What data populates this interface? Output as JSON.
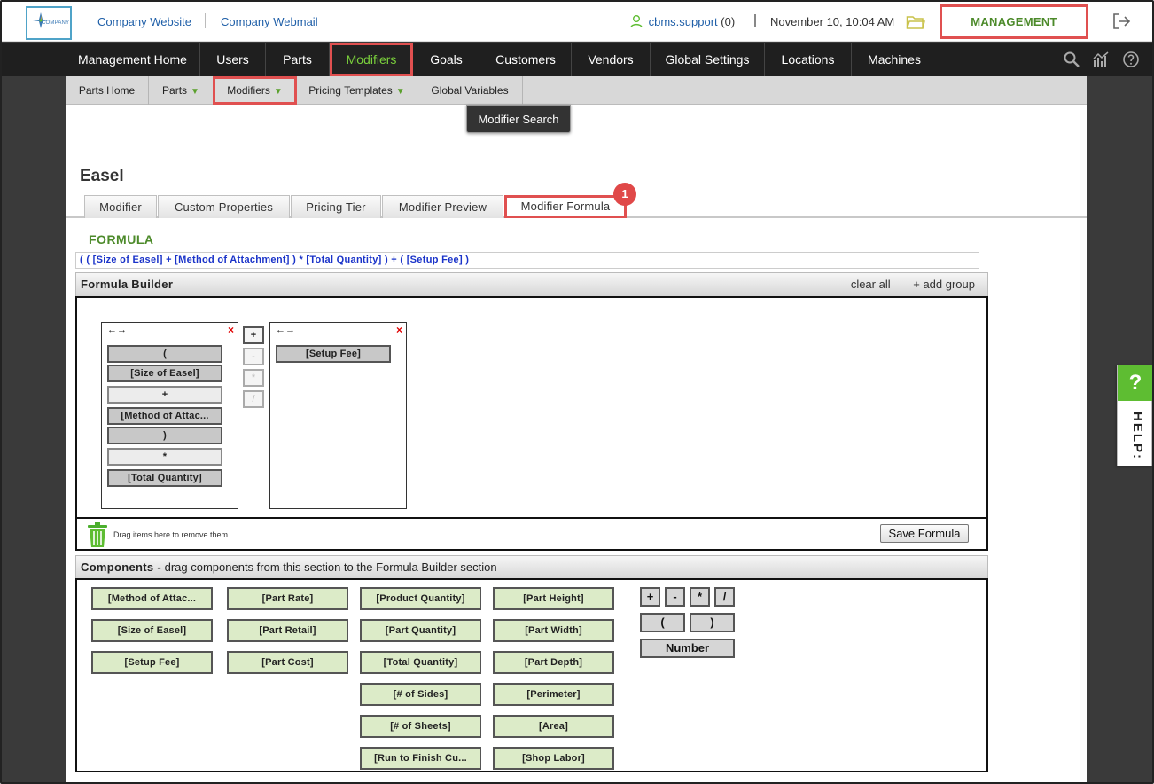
{
  "topbar": {
    "logo_text": "COMPANY",
    "links": [
      "Company Website",
      "Company Webmail"
    ],
    "user": "cbms.support",
    "user_count": "(0)",
    "date": "November 10, 10:04 AM",
    "management": "MANAGEMENT"
  },
  "mainnav": {
    "items": [
      "Management Home",
      "Users",
      "Parts",
      "Modifiers",
      "Goals",
      "Customers",
      "Vendors",
      "Global Settings",
      "Locations",
      "Machines"
    ],
    "active": "Modifiers"
  },
  "subnav": {
    "items": [
      "Parts Home",
      "Parts",
      "Modifiers",
      "Pricing Templates",
      "Global Variables"
    ],
    "active": "Modifiers",
    "dropdown": "Modifier Search"
  },
  "page": {
    "title": "Easel",
    "tabs": [
      "Modifier",
      "Custom Properties",
      "Pricing Tier",
      "Modifier Preview",
      "Modifier Formula"
    ],
    "active_tab": "Modifier Formula",
    "badge": "1"
  },
  "formula": {
    "label": "FORMULA",
    "text": "( ( [Size of Easel] + [Method of Attachment] ) * [Total Quantity] ) + ( [Setup Fee] )"
  },
  "builder": {
    "title": "Formula Builder",
    "clear_all": "clear all",
    "add_group": "+ add group",
    "group_arrows": "←→",
    "remove": "×",
    "group1": [
      "(",
      "[Size of Easel]",
      "+",
      "[Method of Attac...",
      ")",
      "*",
      "[Total Quantity]"
    ],
    "operators": [
      "+",
      "-",
      "*",
      "/"
    ],
    "group2": [
      "[Setup Fee]"
    ],
    "trash_text": "Drag items here to remove them.",
    "save": "Save Formula"
  },
  "components": {
    "title": "Components -",
    "subtitle": "drag components from this section to the Formula Builder section",
    "col1": [
      "[Method of Attac...",
      "[Size of Easel]",
      "[Setup Fee]"
    ],
    "col2": [
      "[Part Rate]",
      "[Part Retail]",
      "[Part Cost]"
    ],
    "col3": [
      "[Product Quantity]",
      "[Part Quantity]",
      "[Total Quantity]",
      "[# of Sides]",
      "[# of Sheets]",
      "[Run to Finish Cu..."
    ],
    "col4": [
      "[Part Height]",
      "[Part Width]",
      "[Part Depth]",
      "[Perimeter]",
      "[Area]",
      "[Shop Labor]"
    ],
    "ops": [
      "+",
      "-",
      "*",
      "/"
    ],
    "parens": [
      "(",
      ")"
    ],
    "number": "Number"
  },
  "help": {
    "q": "?",
    "label": "HELP:"
  },
  "colors": {
    "accent_green": "#4c8a2a",
    "highlight_red": "#e05050",
    "nav_bg": "#1f1f1f",
    "component_bg": "#dcebc8"
  }
}
